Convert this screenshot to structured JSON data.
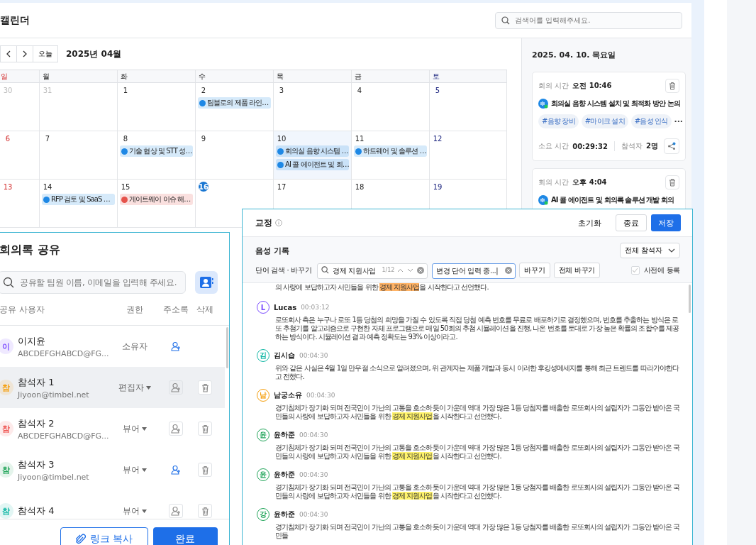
{
  "calendar": {
    "title": "캘린더",
    "search": {
      "placeholder": "검색어를 입력해주세요."
    },
    "today_button": "오늘",
    "month": "2025년 04월",
    "weekdays": [
      {
        "label": "일",
        "kind": "sun"
      },
      {
        "label": "월",
        "kind": "weekday"
      },
      {
        "label": "화",
        "kind": "weekday"
      },
      {
        "label": "수",
        "kind": "weekday"
      },
      {
        "label": "목",
        "kind": "weekday"
      },
      {
        "label": "금",
        "kind": "weekday"
      },
      {
        "label": "토",
        "kind": "sat"
      }
    ],
    "weeks": [
      {
        "days": [
          {
            "date": "30",
            "kind": "other",
            "today": false,
            "selected": false
          },
          {
            "date": "31",
            "kind": "other",
            "today": false,
            "selected": false
          },
          {
            "date": "1",
            "kind": "weekday",
            "today": false,
            "selected": false
          },
          {
            "date": "2",
            "kind": "weekday",
            "today": false,
            "selected": false,
            "events": [
              {
                "title": "팀블로의 제품 라인…",
                "color": "#1e88e5"
              }
            ]
          },
          {
            "date": "3",
            "kind": "weekday",
            "today": false,
            "selected": false
          },
          {
            "date": "4",
            "kind": "weekday",
            "today": false,
            "selected": false
          },
          {
            "date": "5",
            "kind": "sat",
            "today": false,
            "selected": false
          }
        ]
      },
      {
        "days": [
          {
            "date": "6",
            "kind": "sun",
            "today": false,
            "selected": false
          },
          {
            "date": "7",
            "kind": "weekday",
            "today": false,
            "selected": false
          },
          {
            "date": "8",
            "kind": "weekday",
            "today": false,
            "selected": false,
            "events": [
              {
                "title": "기술 협상 및 STT 성…",
                "color": "#1e88e5"
              }
            ]
          },
          {
            "date": "9",
            "kind": "weekday",
            "today": false,
            "selected": false
          },
          {
            "date": "10",
            "kind": "weekday",
            "today": false,
            "selected": true,
            "events": [
              {
                "title": "회의실 음향 시스템 …",
                "color": "#1e88e5"
              },
              {
                "title": "AI 콜 에이전트 및 회…",
                "color": "#1e88e5"
              }
            ]
          },
          {
            "date": "11",
            "kind": "weekday",
            "today": false,
            "selected": false,
            "events": [
              {
                "title": "하드웨어 및 솔루션 …",
                "color": "#1e88e5"
              }
            ]
          },
          {
            "date": "12",
            "kind": "sat",
            "today": false,
            "selected": false
          }
        ]
      },
      {
        "days": [
          {
            "date": "13",
            "kind": "sun",
            "today": false,
            "selected": false
          },
          {
            "date": "14",
            "kind": "weekday",
            "today": false,
            "selected": false,
            "events": [
              {
                "title": "RFP 검토 및 SaaS …",
                "color": "#1e88e5"
              }
            ]
          },
          {
            "date": "15",
            "kind": "weekday",
            "today": false,
            "selected": false,
            "events": [
              {
                "title": "게이트웨이 이슈 해…",
                "color": "#e5534b"
              }
            ]
          },
          {
            "date": "16",
            "kind": "weekday",
            "today": true,
            "selected": false
          },
          {
            "date": "17",
            "kind": "weekday",
            "today": false,
            "selected": false
          },
          {
            "date": "18",
            "kind": "weekday",
            "today": false,
            "selected": false
          },
          {
            "date": "19",
            "kind": "sat",
            "today": false,
            "selected": false
          }
        ]
      }
    ]
  },
  "day_panel": {
    "date": "2025. 04. 10. 목요일",
    "meetings": [
      {
        "time_label": "회의 시간",
        "time": "오전 10:46",
        "title": "회의실 음향 시스템 설치 및 최적화 방안 논의",
        "tags": [
          "#음향 장비",
          "#마이크 설치",
          "#음성 인식"
        ],
        "more": "···",
        "duration_label": "소요 시간",
        "duration": "00:29:32",
        "attendees_label": "참석자",
        "attendees": "2명"
      },
      {
        "time_label": "회의 시간",
        "time": "오후 4:04",
        "title": "AI 콜 에이전트 및 회의록 솔루션 개발 회의"
      }
    ]
  },
  "share": {
    "title": "회의록 공유",
    "search": {
      "placeholder": "공유할 팀원 이름, 이메일을 입력해 주세요."
    },
    "columns": [
      "공유 사용자",
      "권한",
      "주소록",
      "삭제"
    ],
    "users": [
      {
        "initial": "이",
        "color": "#7c4dff",
        "name": "이지윤",
        "email": "ABCDEFGHABCD@FG...",
        "role": "소유자",
        "role_menu": false,
        "in_contacts": true,
        "deletable": false,
        "selected": false
      },
      {
        "initial": "참",
        "color": "#f59e0b",
        "name": "참석자 1",
        "email": "Jiyoon@timbel.net",
        "role": "편집자",
        "role_menu": true,
        "in_contacts": false,
        "deletable": true,
        "selected": true
      },
      {
        "initial": "참",
        "color": "#ef5350",
        "name": "참석자 2",
        "email": "ABCDEFGHABCD@FG...",
        "role": "뷰어",
        "role_menu": true,
        "in_contacts": false,
        "deletable": true,
        "selected": false
      },
      {
        "initial": "참",
        "color": "#22a55a",
        "name": "참석자 3",
        "email": "Jiyoon@timbel.net",
        "role": "뷰어",
        "role_menu": true,
        "in_contacts": true,
        "deletable": true,
        "selected": false
      },
      {
        "initial": "참",
        "color": "#14b8a6",
        "name": "참석자 4",
        "role": "뷰어",
        "role_menu": true,
        "in_contacts": false,
        "deletable": true,
        "selected": false
      }
    ],
    "buttons": [
      {
        "label": "링크 복사",
        "kind": "secondary"
      },
      {
        "label": "완료",
        "kind": "primary"
      }
    ]
  },
  "correction": {
    "title": "교정",
    "actions": [
      {
        "label": "초기화",
        "kind": "text"
      },
      {
        "label": "종료",
        "kind": "outline"
      },
      {
        "label": "저장",
        "kind": "primary"
      }
    ],
    "section": "음성 기록",
    "speaker_filter": "전체 참석자",
    "search_label": "단어 검색 · 바꾸기",
    "search": {
      "value": "경제 지원사업",
      "count": "1/12"
    },
    "replace": {
      "value": "변경 단어 입력 중...|",
      "focused": true
    },
    "replace_buttons": [
      "바꾸기",
      "전체 바꾸기"
    ],
    "dictionary": {
      "label": "사전에 등록",
      "checked": false
    },
    "entries": [
      {
        "parts": [
          {
            "text": "의 사랑에 보답하고자 서민들을 위한 "
          },
          {
            "text": "경제 지원사업",
            "kind": "current"
          },
          {
            "text": "을 시작한다고 선언했다."
          }
        ]
      },
      {
        "initial": "L",
        "color": "#7c4dff",
        "name": "Lucas",
        "time": "00:03:12",
        "parts": [
          {
            "text": "로또회사 측은 누구나 로또 1등 당첨의 희망을 가질 수 있도록 직접 당첨 예측 번호를 무료로 배포하기로 결정했으며, 번호를 추출하는 방식은 로또 추첨기를 알고리즘으로 구현한 자체 프로그램으로 매일 50회의 추첨 시뮬레이션을 진행, 나온 번호를 토대로 가장 높은 확률의 조합수를 제공하는 방식이다. 시뮬레이션 결과 예측 정확도는 93% 이상이라고."
          }
        ]
      },
      {
        "initial": "김",
        "color": "#14b8a6",
        "name": "김시습",
        "time": "00:04:30",
        "parts": [
          {
            "text": "위와 같은 사실은 4월 1일 만우절 소식으로 알려졌으며, 위 관계자는 제품 개발과 동시 이러한 후킹성메세지를 통해 최근 트렌드를 따라가야한다고 전했다."
          }
        ]
      },
      {
        "initial": "남",
        "color": "#f59e0b",
        "name": "남궁소유",
        "time": "00:04:30",
        "parts": [
          {
            "text": "경기침체가 장기화 되며 전국민이 가난의 고통을 호소하듯이 가운데 역대 가장 많은 1등 당첨자를 배출한 로또회사의 설립자가 그동안 받아온 국민들의 사랑에 보답하고자 서민들을 위한 "
          },
          {
            "text": "경제 지원사업",
            "kind": "match"
          },
          {
            "text": "을 시작한다고 선언했다."
          }
        ]
      },
      {
        "initial": "윤",
        "color": "#22a55a",
        "name": "윤하준",
        "time": "00:04:30",
        "parts": [
          {
            "text": "경기침체가 장기화 되며 전국민이 가난의 고통을 호소하듯이 가운데 역대 가장 많은 1등 당첨자를 배출한 로또회사의 설립자가 그동안 받아온 국민들의 사랑에 보답하고자 서민들을 위한 "
          },
          {
            "text": "경제 지원사업",
            "kind": "match"
          },
          {
            "text": "을 시작한다고 선언했다."
          }
        ]
      },
      {
        "initial": "윤",
        "color": "#22a55a",
        "name": "윤하준",
        "time": "00:04:30",
        "parts": [
          {
            "text": "경기침체가 장기화 되며 전국민이 가난의 고통을 호소하듯이 가운데 역대 가장 많은 1등 당첨자를 배출한 로또회사의 설립자가 그동안 받아온 국민들의 사랑에 보답하고자 서민들을 위한 "
          },
          {
            "text": "경제 지원사업",
            "kind": "match"
          },
          {
            "text": "을 시작한다고 선언했다."
          }
        ]
      },
      {
        "initial": "강",
        "color": "#22a55a",
        "name": "윤하준",
        "time": "00:04:30",
        "parts": [
          {
            "text": "경기침체가 장기화 되며 전국민이 가난의 고통을 호소하듯이 가운데 역대 가장 많은 1등 당첨자를 배출한 로또회사의 설립자가 그동안 받아온 국민들"
          }
        ]
      }
    ]
  }
}
